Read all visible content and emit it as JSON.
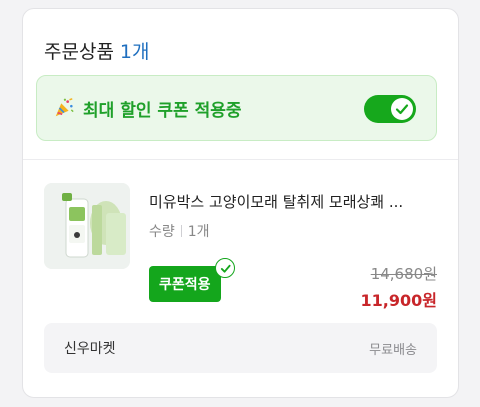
{
  "header": {
    "title": "주문상품",
    "count": "1개"
  },
  "coupon_banner": {
    "label": "최대 할인 쿠폰 적용중",
    "toggle_on": true,
    "accent": "#16a81c"
  },
  "product": {
    "title": "미유박스 고양이모래 탈취제 모래상쾌 ...",
    "qty_label": "수량",
    "qty_value": "1개",
    "coupon_badge": "쿠폰적용",
    "original_price": "14,680원",
    "sale_price": "11,900원",
    "sale_color": "#c8262a"
  },
  "footer": {
    "seller": "신우마켓",
    "shipping": "무료배송"
  }
}
